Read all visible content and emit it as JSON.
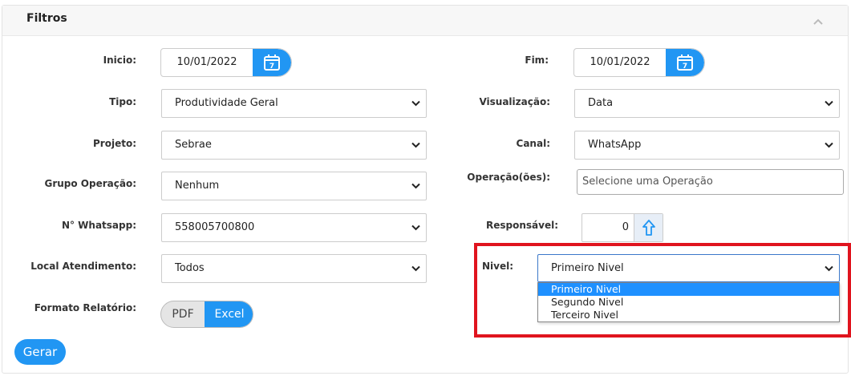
{
  "panel": {
    "title": "Filtros"
  },
  "labels": {
    "inicio": "Inicio:",
    "fim": "Fim:",
    "tipo": "Tipo:",
    "visualizacao": "Visualização:",
    "projeto": "Projeto:",
    "canal": "Canal:",
    "grupo_operacao": "Grupo Operação:",
    "operacoes": "Operação(ões):",
    "whatsapp": "N° Whatsapp:",
    "responsavel": "Responsável:",
    "local_atendimento": "Local Atendimento:",
    "nivel": "Nivel:",
    "formato_relatorio": "Formato Relatório:"
  },
  "values": {
    "inicio": "10/01/2022",
    "fim": "10/01/2022",
    "tipo": "Produtividade Geral",
    "visualizacao": "Data",
    "projeto": "Sebrae",
    "canal": "WhatsApp",
    "grupo_operacao": "Nenhum",
    "whatsapp": "558005700800",
    "responsavel": "0",
    "local_atendimento": "Todos",
    "nivel": "Primeiro Nivel"
  },
  "operacoes": {
    "placeholder": "Selecione uma Operação"
  },
  "nivel_options": [
    "Primeiro Nivel",
    "Segundo Nivel",
    "Terceiro Nivel"
  ],
  "calendar_day": "7",
  "formato": {
    "pdf": "PDF",
    "excel": "Excel",
    "selected": "Excel"
  },
  "gerar_label": "Gerar",
  "colors": {
    "accent": "#2196f3",
    "highlight": "#e0141e",
    "dropdown_selected": "#1e90ff"
  },
  "icons": {
    "calendar": "calendar-icon",
    "collapse": "chevron-up-icon",
    "select": "chevron-down-icon",
    "stepper": "arrow-up-icon"
  }
}
